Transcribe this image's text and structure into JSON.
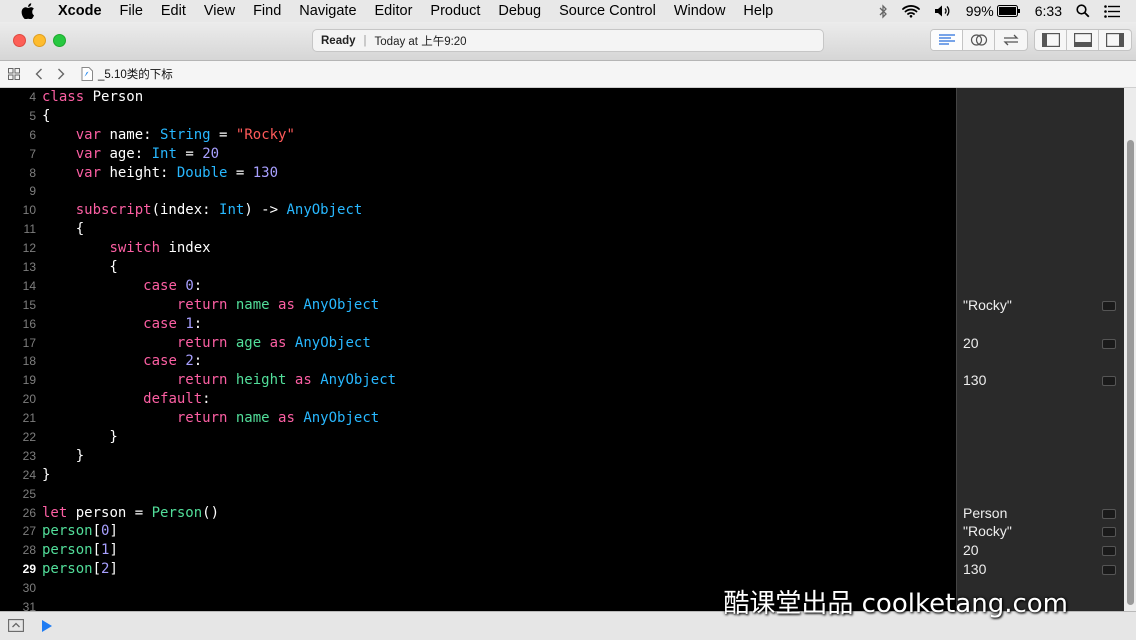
{
  "menubar": {
    "app_name": "Xcode",
    "items": [
      "File",
      "Edit",
      "View",
      "Find",
      "Navigate",
      "Editor",
      "Product",
      "Debug",
      "Source Control",
      "Window",
      "Help"
    ],
    "battery": "99%",
    "clock": "6:33"
  },
  "toolbar": {
    "status_ready": "Ready",
    "status_separator": "|",
    "status_time": "Today at 上午9:20"
  },
  "jumpbar": {
    "filename": "_5.10类的下标"
  },
  "editor": {
    "current_line": 29,
    "lines": [
      {
        "n": "4",
        "tokens": [
          {
            "t": "class",
            "c": "kw"
          },
          {
            "t": " Person",
            "c": "plain"
          }
        ]
      },
      {
        "n": "5",
        "tokens": [
          {
            "t": "{",
            "c": "plain"
          }
        ]
      },
      {
        "n": "6",
        "tokens": [
          {
            "t": "    ",
            "c": "plain"
          },
          {
            "t": "var",
            "c": "kw"
          },
          {
            "t": " name: ",
            "c": "plain"
          },
          {
            "t": "String",
            "c": "type"
          },
          {
            "t": " = ",
            "c": "plain"
          },
          {
            "t": "\"Rocky\"",
            "c": "str"
          }
        ]
      },
      {
        "n": "7",
        "tokens": [
          {
            "t": "    ",
            "c": "plain"
          },
          {
            "t": "var",
            "c": "kw"
          },
          {
            "t": " age: ",
            "c": "plain"
          },
          {
            "t": "Int",
            "c": "type"
          },
          {
            "t": " = ",
            "c": "plain"
          },
          {
            "t": "20",
            "c": "num"
          }
        ]
      },
      {
        "n": "8",
        "tokens": [
          {
            "t": "    ",
            "c": "plain"
          },
          {
            "t": "var",
            "c": "kw"
          },
          {
            "t": " height: ",
            "c": "plain"
          },
          {
            "t": "Double",
            "c": "type"
          },
          {
            "t": " = ",
            "c": "plain"
          },
          {
            "t": "130",
            "c": "num"
          }
        ]
      },
      {
        "n": "9",
        "tokens": []
      },
      {
        "n": "10",
        "tokens": [
          {
            "t": "    ",
            "c": "plain"
          },
          {
            "t": "subscript",
            "c": "kw"
          },
          {
            "t": "(index: ",
            "c": "plain"
          },
          {
            "t": "Int",
            "c": "type"
          },
          {
            "t": ") -> ",
            "c": "plain"
          },
          {
            "t": "AnyObject",
            "c": "type"
          }
        ]
      },
      {
        "n": "11",
        "tokens": [
          {
            "t": "    {",
            "c": "plain"
          }
        ]
      },
      {
        "n": "12",
        "tokens": [
          {
            "t": "        ",
            "c": "plain"
          },
          {
            "t": "switch",
            "c": "kw"
          },
          {
            "t": " index",
            "c": "plain"
          }
        ]
      },
      {
        "n": "13",
        "tokens": [
          {
            "t": "        {",
            "c": "plain"
          }
        ]
      },
      {
        "n": "14",
        "tokens": [
          {
            "t": "            ",
            "c": "plain"
          },
          {
            "t": "case",
            "c": "kw"
          },
          {
            "t": " ",
            "c": "plain"
          },
          {
            "t": "0",
            "c": "num"
          },
          {
            "t": ":",
            "c": "plain"
          }
        ]
      },
      {
        "n": "15",
        "tokens": [
          {
            "t": "                ",
            "c": "plain"
          },
          {
            "t": "return",
            "c": "kw"
          },
          {
            "t": " ",
            "c": "plain"
          },
          {
            "t": "name",
            "c": "ident"
          },
          {
            "t": " ",
            "c": "plain"
          },
          {
            "t": "as",
            "c": "kw"
          },
          {
            "t": " ",
            "c": "plain"
          },
          {
            "t": "AnyObject",
            "c": "type"
          }
        ]
      },
      {
        "n": "16",
        "tokens": [
          {
            "t": "            ",
            "c": "plain"
          },
          {
            "t": "case",
            "c": "kw"
          },
          {
            "t": " ",
            "c": "plain"
          },
          {
            "t": "1",
            "c": "num"
          },
          {
            "t": ":",
            "c": "plain"
          }
        ]
      },
      {
        "n": "17",
        "tokens": [
          {
            "t": "                ",
            "c": "plain"
          },
          {
            "t": "return",
            "c": "kw"
          },
          {
            "t": " ",
            "c": "plain"
          },
          {
            "t": "age",
            "c": "ident"
          },
          {
            "t": " ",
            "c": "plain"
          },
          {
            "t": "as",
            "c": "kw"
          },
          {
            "t": " ",
            "c": "plain"
          },
          {
            "t": "AnyObject",
            "c": "type"
          }
        ]
      },
      {
        "n": "18",
        "tokens": [
          {
            "t": "            ",
            "c": "plain"
          },
          {
            "t": "case",
            "c": "kw"
          },
          {
            "t": " ",
            "c": "plain"
          },
          {
            "t": "2",
            "c": "num"
          },
          {
            "t": ":",
            "c": "plain"
          }
        ]
      },
      {
        "n": "19",
        "tokens": [
          {
            "t": "                ",
            "c": "plain"
          },
          {
            "t": "return",
            "c": "kw"
          },
          {
            "t": " ",
            "c": "plain"
          },
          {
            "t": "height",
            "c": "ident"
          },
          {
            "t": " ",
            "c": "plain"
          },
          {
            "t": "as",
            "c": "kw"
          },
          {
            "t": " ",
            "c": "plain"
          },
          {
            "t": "AnyObject",
            "c": "type"
          }
        ]
      },
      {
        "n": "20",
        "tokens": [
          {
            "t": "            ",
            "c": "plain"
          },
          {
            "t": "default",
            "c": "kw"
          },
          {
            "t": ":",
            "c": "plain"
          }
        ]
      },
      {
        "n": "21",
        "tokens": [
          {
            "t": "                ",
            "c": "plain"
          },
          {
            "t": "return",
            "c": "kw"
          },
          {
            "t": " ",
            "c": "plain"
          },
          {
            "t": "name",
            "c": "ident"
          },
          {
            "t": " ",
            "c": "plain"
          },
          {
            "t": "as",
            "c": "kw"
          },
          {
            "t": " ",
            "c": "plain"
          },
          {
            "t": "AnyObject",
            "c": "type"
          }
        ]
      },
      {
        "n": "22",
        "tokens": [
          {
            "t": "        }",
            "c": "plain"
          }
        ]
      },
      {
        "n": "23",
        "tokens": [
          {
            "t": "    }",
            "c": "plain"
          }
        ]
      },
      {
        "n": "24",
        "tokens": [
          {
            "t": "}",
            "c": "plain"
          }
        ]
      },
      {
        "n": "25",
        "tokens": []
      },
      {
        "n": "26",
        "tokens": [
          {
            "t": "let",
            "c": "kw"
          },
          {
            "t": " person = ",
            "c": "plain"
          },
          {
            "t": "Person",
            "c": "ident"
          },
          {
            "t": "()",
            "c": "plain"
          }
        ]
      },
      {
        "n": "27",
        "tokens": [
          {
            "t": "person",
            "c": "ident"
          },
          {
            "t": "[",
            "c": "plain"
          },
          {
            "t": "0",
            "c": "num"
          },
          {
            "t": "]",
            "c": "plain"
          }
        ]
      },
      {
        "n": "28",
        "tokens": [
          {
            "t": "person",
            "c": "ident"
          },
          {
            "t": "[",
            "c": "plain"
          },
          {
            "t": "1",
            "c": "num"
          },
          {
            "t": "]",
            "c": "plain"
          }
        ]
      },
      {
        "n": "29",
        "tokens": [
          {
            "t": "person",
            "c": "ident"
          },
          {
            "t": "[",
            "c": "plain"
          },
          {
            "t": "2",
            "c": "num"
          },
          {
            "t": "]",
            "c": "plain"
          }
        ]
      },
      {
        "n": "30",
        "tokens": []
      },
      {
        "n": "31",
        "tokens": []
      }
    ]
  },
  "results": {
    "15": "\"Rocky\"",
    "17": "20",
    "19": "130",
    "26": "Person",
    "27": "\"Rocky\"",
    "28": "20",
    "29": "130"
  },
  "watermark": "酷课堂出品 coolketang.com",
  "colors": {
    "keyword": "#fc5fa3",
    "type": "#28b8ff",
    "number": "#a8a0ff",
    "string": "#ff5a5a",
    "identifier": "#52de9a",
    "editor_bg": "#000000",
    "results_bg": "#2a2a2a"
  }
}
